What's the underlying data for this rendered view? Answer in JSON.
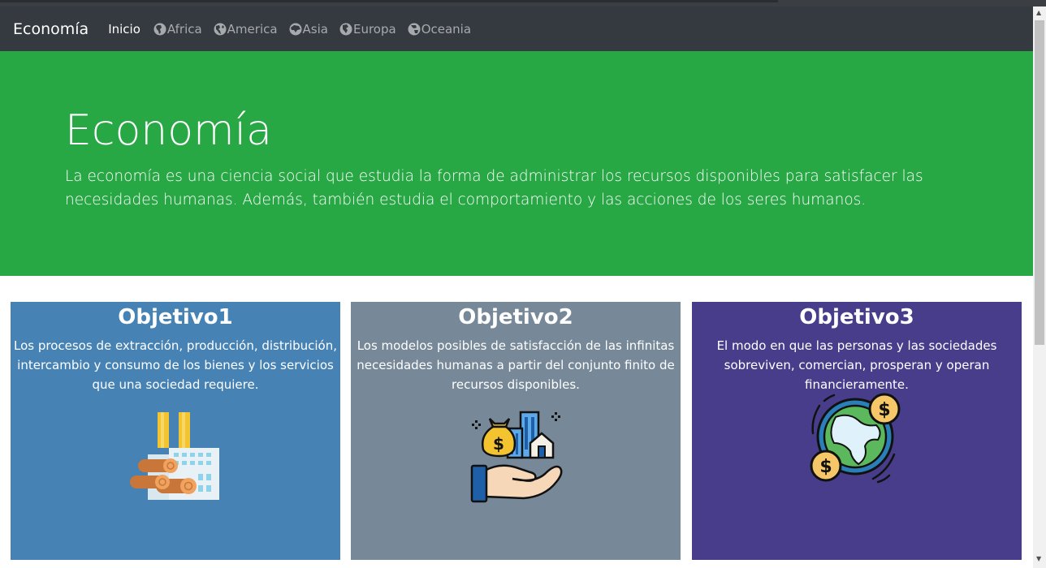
{
  "nav": {
    "brand": "Economía",
    "items": [
      {
        "label": "Inicio",
        "icon": "none"
      },
      {
        "label": "Africa",
        "icon": "globe-africa-icon"
      },
      {
        "label": "America",
        "icon": "globe-americas-icon"
      },
      {
        "label": "Asia",
        "icon": "globe-asia-icon"
      },
      {
        "label": "Europa",
        "icon": "globe-europe-icon"
      },
      {
        "label": "Oceania",
        "icon": "globe-oceania-icon"
      }
    ]
  },
  "hero": {
    "title": "Economía",
    "text": "La economía es una ciencia social que estudia la forma de administrar los recursos disponibles para satisfacer las necesidades humanas. Además, también estudia el comportamiento y las acciones de los seres humanos."
  },
  "cards": [
    {
      "title": "Objetivo1",
      "text": "Los procesos de extracción, producción, distribución, intercambio y consumo de los bienes y los servicios que una sociedad requiere.",
      "image": "factory-wood-icon",
      "color": "#4682b4"
    },
    {
      "title": "Objetivo2",
      "text": "Los modelos posibles de satisfacción de las infinitas necesidades humanas a partir del conjunto finito de recursos disponibles.",
      "image": "hand-money-city-icon",
      "color": "#778899"
    },
    {
      "title": "Objetivo3",
      "text": "El modo en que las personas y las sociedades sobreviven, comercian, prosperan y operan financieramente.",
      "image": "globe-dollar-icon",
      "color": "#483d8b"
    }
  ],
  "colors": {
    "navbar": "#343a40",
    "hero": "#28a745"
  }
}
